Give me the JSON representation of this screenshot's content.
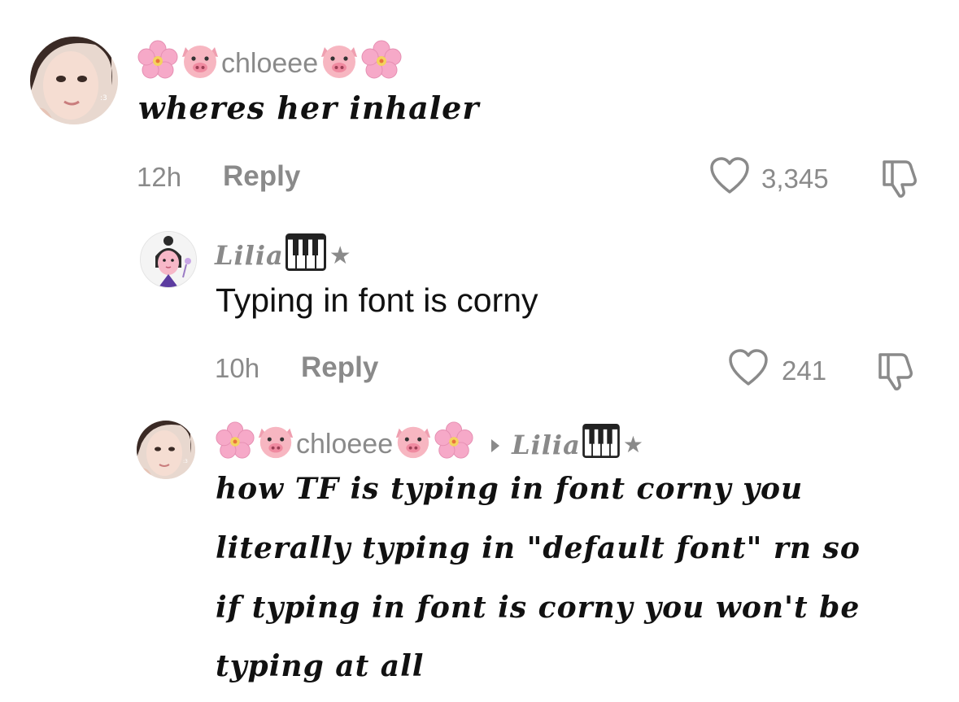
{
  "comments": [
    {
      "username": "chloeee",
      "text": "wheres her inhaler",
      "time": "12h",
      "reply_label": "Reply",
      "likes": "3,345"
    },
    {
      "username": "Lilia",
      "text": "Typing in font is corny",
      "time": "10h",
      "reply_label": "Reply",
      "likes": "241"
    },
    {
      "username": "chloeee",
      "reply_to": "Lilia",
      "text_lines": [
        "how TF is typing in font corny you",
        "literally typing in \"default font\" rn so",
        "if typing in font is corny you won't be",
        "typing at all"
      ]
    }
  ],
  "icons": {
    "like": "heart-outline-icon",
    "dislike": "thumbs-down-icon",
    "reply_arrow": "caret-right-icon",
    "decor": [
      "cherry-blossom-emoji",
      "pig-face-emoji",
      "piano-keys-icon",
      "star-icon"
    ]
  },
  "colors": {
    "text_primary": "#111111",
    "text_secondary": "#8a8a8a",
    "blossom": "#f6a9c8",
    "pig": "#f7b6c1"
  }
}
